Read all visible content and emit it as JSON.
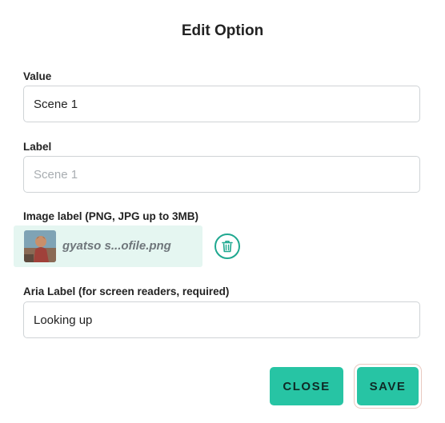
{
  "dialog": {
    "title": "Edit Option"
  },
  "fields": {
    "value": {
      "label": "Value",
      "value": "Scene 1"
    },
    "label": {
      "label": "Label",
      "value": "",
      "placeholder": "Scene 1"
    },
    "image": {
      "label": "Image label (PNG, JPG up to 3MB)",
      "file_name": "gyatso s...ofile.png",
      "delete_icon": "trash-icon"
    },
    "aria": {
      "label": "Aria Label (for screen readers, required)",
      "value": "Looking up"
    }
  },
  "actions": {
    "close_label": "CLOSE",
    "save_label": "SAVE"
  },
  "colors": {
    "accent": "#27c4a4",
    "accent_dark": "#1fa890",
    "chip_background": "#e5f6f1"
  }
}
